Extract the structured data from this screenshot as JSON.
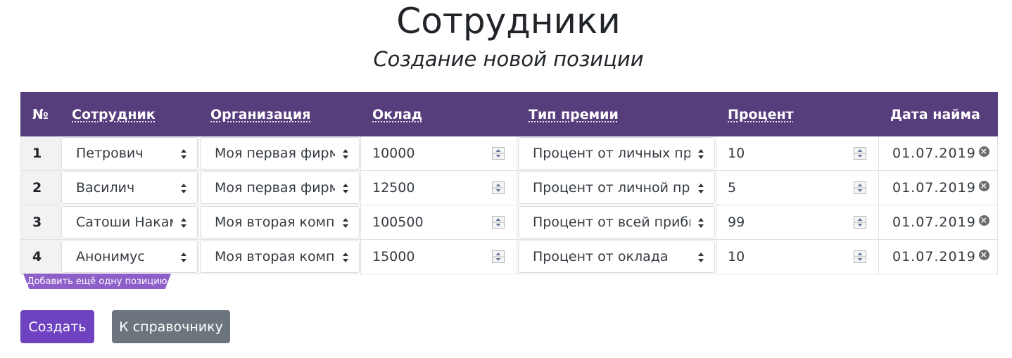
{
  "header": {
    "title": "Сотрудники",
    "subtitle": "Создание новой позиции"
  },
  "table": {
    "columns": [
      "№",
      "Сотрудник",
      "Организация",
      "Оклад",
      "Тип премии",
      "Процент",
      "Дата найма"
    ],
    "rows": [
      {
        "num": "1",
        "employee": "Петрович",
        "organization": "Моя первая фирма",
        "salary": "10000",
        "bonus_type": "Процент от личных продаж",
        "percent": "10",
        "hire_date": "01.07.2019"
      },
      {
        "num": "2",
        "employee": "Василич",
        "organization": "Моя первая фирма",
        "salary": "12500",
        "bonus_type": "Процент от личной прибыли",
        "percent": "5",
        "hire_date": "01.07.2019"
      },
      {
        "num": "3",
        "employee": "Сатоши Накамото",
        "organization": "Моя вторая компания",
        "salary": "100500",
        "bonus_type": "Процент от всей прибыли",
        "percent": "99",
        "hire_date": "01.07.2019"
      },
      {
        "num": "4",
        "employee": "Анонимус",
        "organization": "Моя вторая компания",
        "salary": "15000",
        "bonus_type": "Процент от оклада",
        "percent": "10",
        "hire_date": "01.07.2019"
      }
    ]
  },
  "add_row_label": "Добавить ещё одну позицию",
  "buttons": {
    "create": "Создать",
    "reference": "К справочнику"
  },
  "colors": {
    "header_bg": "#563d7c",
    "create_button": "#6f42c1",
    "reference_button": "#6c757d",
    "add_tag": "#8e5ec9"
  },
  "icons": [
    "sort-arrows-icon",
    "spinner-icon",
    "clear-icon"
  ]
}
